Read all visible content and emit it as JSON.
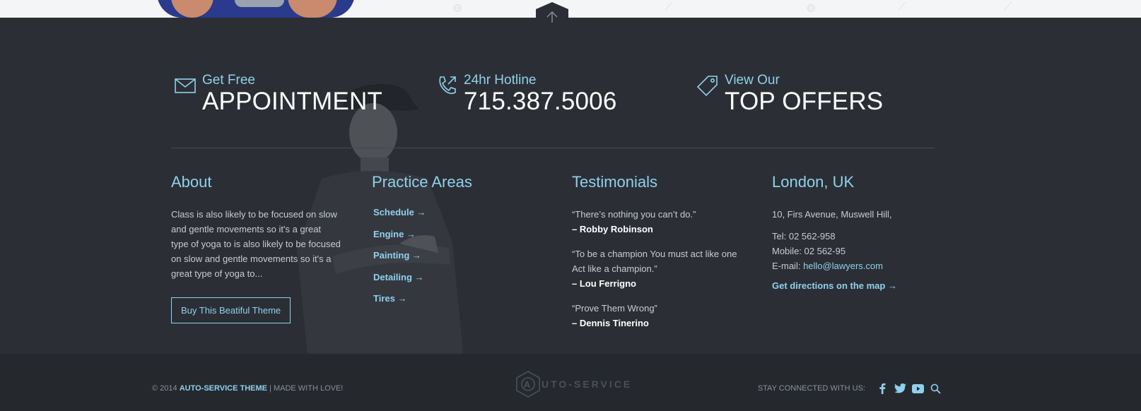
{
  "cta": {
    "appointment": {
      "small": "Get Free",
      "big": "APPOINTMENT",
      "icon": "envelope-icon"
    },
    "hotline": {
      "small": "24hr Hotline",
      "big": "715.387.5006",
      "icon": "phone-icon"
    },
    "offers": {
      "small": "View Our",
      "big": "TOP OFFERS",
      "icon": "tag-icon"
    }
  },
  "about": {
    "heading": "About",
    "text": "Class is also likely to be focused on slow and gentle movements so it's a great type of yoga to is also likely to be focused on slow and gentle movements so it's a great type of yoga to...",
    "button": "Buy This Beatiful Theme"
  },
  "practice": {
    "heading": "Practice Areas",
    "items": [
      "Schedule →",
      "Engine →",
      "Painting →",
      "Detailing →",
      "Tires →"
    ]
  },
  "testimonials": {
    "heading": "Testimonials",
    "quotes": [
      {
        "text": "“There’s nothing you can’t do.”",
        "author": "– Robby Robinson"
      },
      {
        "text": "“To be a champion You must act like one Act like a champion.”",
        "author": "– Lou Ferrigno"
      },
      {
        "text": "“Prove Them Wrong”",
        "author": "– Dennis Tinerino"
      }
    ]
  },
  "london": {
    "heading": "London, UK",
    "address": "10, Firs Avenue, Muswell Hill,",
    "tel": "Tel: 02 562-958",
    "mobile": "Mobile: 02 562-95",
    "email_label": "E-mail: ",
    "email": "hello@lawyers.com",
    "directions": "Get directions on the map →"
  },
  "bottom": {
    "copyright_prefix": "© 2014 ",
    "brand": "AUTO-SERVICE THEME",
    "copyright_suffix": " | MADE WITH LOVE!",
    "logo_letter": "A",
    "logo_text": "UTO-SERVICE",
    "stay": "STAY CONNECTED WITH US:"
  },
  "colors": {
    "accent": "#8fd0ec",
    "background": "#2b2f35",
    "bottom_bar": "#25292e"
  }
}
